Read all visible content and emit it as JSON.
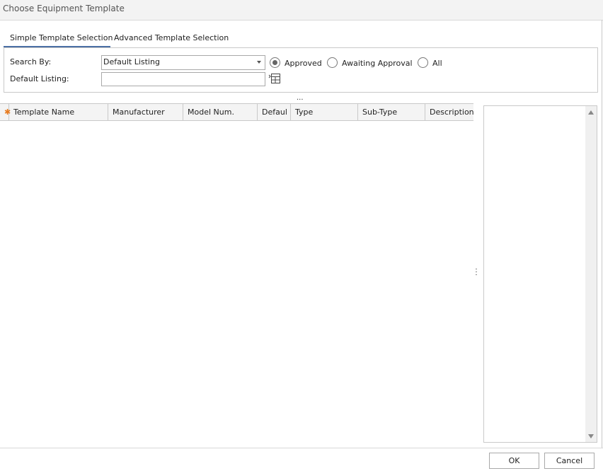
{
  "window": {
    "title": "Choose Equipment Template"
  },
  "tabs": [
    {
      "label": "Simple Template Selection",
      "active": true
    },
    {
      "label": "Advanced Template Selection",
      "active": false
    }
  ],
  "search": {
    "search_by_label": "Search By:",
    "search_by_value": "Default Listing",
    "default_listing_label": "Default Listing:",
    "default_listing_value": ""
  },
  "status_filter": {
    "options": [
      {
        "label": "Approved",
        "selected": true
      },
      {
        "label": "Awaiting Approval",
        "selected": false
      },
      {
        "label": "All",
        "selected": false
      }
    ]
  },
  "grid": {
    "new_row_marker": "✱",
    "columns": [
      "Template Name",
      "Manufacturer",
      "Model Num.",
      "Defaul",
      "Type",
      "Sub-Type",
      "Description"
    ],
    "rows": []
  },
  "splitter_glyph": "...",
  "buttons": {
    "ok": "OK",
    "cancel_accel": "C",
    "cancel_rest": "ancel"
  },
  "colors": {
    "accent": "#4a6fa5",
    "new_row_star": "#e87b1f"
  }
}
